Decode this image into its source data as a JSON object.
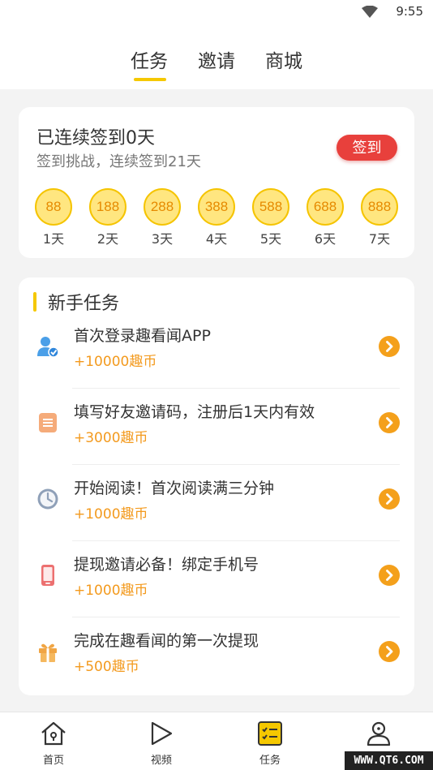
{
  "status_bar": {
    "time": "9:55",
    "wifi_icon": "wifi-icon"
  },
  "top_tabs": [
    {
      "label": "任务",
      "active": true
    },
    {
      "label": "邀请",
      "active": false
    },
    {
      "label": "商城",
      "active": false
    }
  ],
  "checkin": {
    "title": "已连续签到0天",
    "subtitle": "签到挑战，连续签到21天",
    "button_label": "签到",
    "rewards": [
      {
        "coins": "88",
        "day": "1天"
      },
      {
        "coins": "188",
        "day": "2天"
      },
      {
        "coins": "288",
        "day": "3天"
      },
      {
        "coins": "388",
        "day": "4天"
      },
      {
        "coins": "588",
        "day": "5天"
      },
      {
        "coins": "688",
        "day": "6天"
      },
      {
        "coins": "888",
        "day": "7天"
      }
    ]
  },
  "newbie_tasks": {
    "section_title": "新手任务",
    "items": [
      {
        "name": "首次登录趣看闻APP",
        "reward": "+10000趣币",
        "icon": "user-verified-icon"
      },
      {
        "name": "填写好友邀请码，注册后1天内有效",
        "reward": "+3000趣币",
        "icon": "document-icon"
      },
      {
        "name": "开始阅读！首次阅读满三分钟",
        "reward": "+1000趣币",
        "icon": "clock-icon"
      },
      {
        "name": "提现邀请必备！绑定手机号",
        "reward": "+1000趣币",
        "icon": "phone-icon"
      },
      {
        "name": "完成在趣看闻的第一次提现",
        "reward": "+500趣币",
        "icon": "gift-icon"
      }
    ]
  },
  "bottom_nav": [
    {
      "label": "首页",
      "icon": "home-icon"
    },
    {
      "label": "视频",
      "icon": "play-icon"
    },
    {
      "label": "任务",
      "icon": "task-list-icon",
      "active": true
    },
    {
      "label": "",
      "icon": "profile-icon"
    }
  ],
  "watermark": "WWW.QT6.COM",
  "colors": {
    "accent": "#f5c800",
    "sign_button": "#e8403c",
    "reward_text": "#f39a1e",
    "go_button": "#f4a01b"
  }
}
